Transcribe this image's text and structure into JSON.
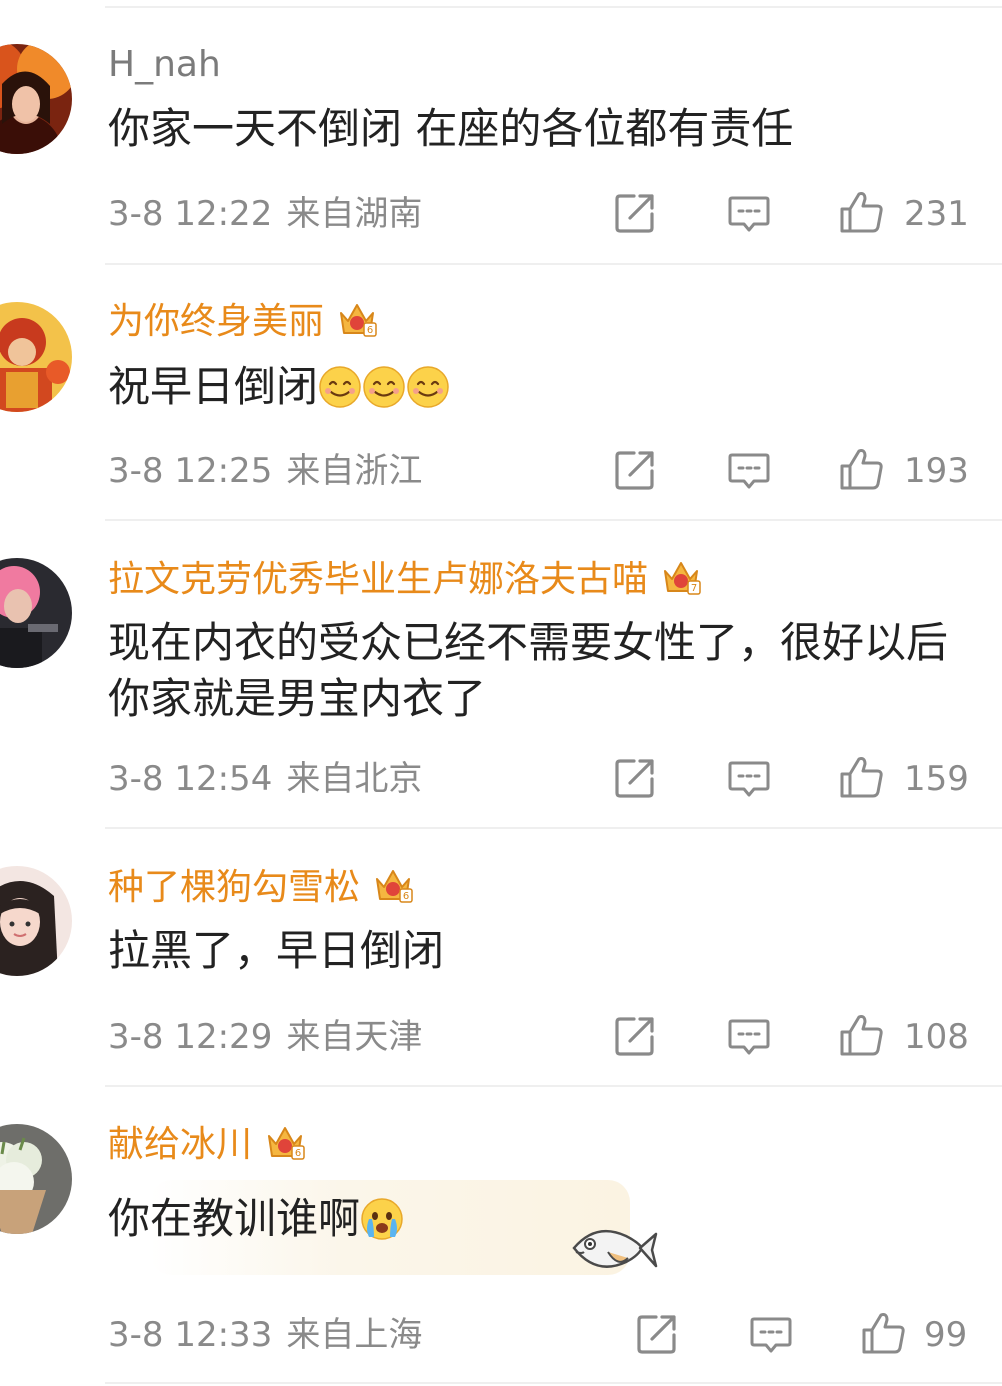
{
  "comments": [
    {
      "username": "H_nah",
      "text": "你家一天不倒闭 在座的各位都有责任",
      "time": "3-8 12:22",
      "location": "来自湖南",
      "likes": "231"
    },
    {
      "username": "为你终身美丽",
      "text": "祝早日倒闭",
      "time": "3-8 12:25",
      "location": "来自浙江",
      "likes": "193"
    },
    {
      "username": "拉文克劳优秀毕业生卢娜洛夫古喵",
      "text": "现在内衣的受众已经不需要女性了，很好以后你家就是男宝内衣了",
      "time": "3-8 12:54",
      "location": "来自北京",
      "likes": "159"
    },
    {
      "username": "种了棵狗勾雪松",
      "text": "拉黑了，早日倒闭",
      "time": "3-8 12:29",
      "location": "来自天津",
      "likes": "108"
    },
    {
      "username": "献给冰川",
      "text": "你在教训谁啊",
      "time": "3-8 12:33",
      "location": "来自上海",
      "likes": "99"
    }
  ],
  "icons": {
    "share": "share-icon",
    "reply": "comment-icon",
    "like": "thumbs-up-icon",
    "vip": "crown-badge-icon",
    "smile": "smile-emoji-icon",
    "cry": "crying-emoji-icon"
  },
  "colors": {
    "vip_name": "#e88a1a",
    "plain_name": "#7b7b7b",
    "meta": "#8a8a8a",
    "text": "#222222"
  }
}
